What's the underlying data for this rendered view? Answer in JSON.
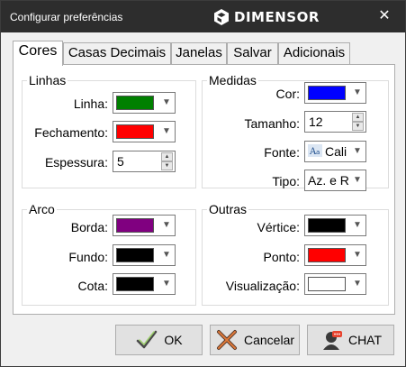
{
  "window": {
    "title": "Configurar preferências",
    "close_glyph": "✕"
  },
  "brand": {
    "name": "DIMENSOR",
    "icon": "dimensor-logo-icon"
  },
  "tabs": [
    {
      "label": "Cores",
      "active": true
    },
    {
      "label": "Casas Decimais",
      "active": false
    },
    {
      "label": "Janelas",
      "active": false
    },
    {
      "label": "Salvar",
      "active": false
    },
    {
      "label": "Adicionais",
      "active": false
    }
  ],
  "linhas": {
    "title": "Linhas",
    "linha": {
      "label": "Linha:",
      "color": "#008000"
    },
    "fechamento": {
      "label": "Fechamento:",
      "color": "#ff0000"
    },
    "espessura": {
      "label": "Espessura:",
      "value": "5"
    }
  },
  "medidas": {
    "title": "Medidas",
    "cor": {
      "label": "Cor:",
      "color": "#0000ff"
    },
    "tamanho": {
      "label": "Tamanho:",
      "value": "12"
    },
    "fonte": {
      "label": "Fonte:",
      "value": "Cali"
    },
    "tipo": {
      "label": "Tipo:",
      "value": "Az. e R"
    }
  },
  "arco": {
    "title": "Arco",
    "borda": {
      "label": "Borda:",
      "color": "#800080"
    },
    "fundo": {
      "label": "Fundo:",
      "color": "#000000"
    },
    "cota": {
      "label": "Cota:",
      "color": "#000000"
    }
  },
  "outras": {
    "title": "Outras",
    "vertice": {
      "label": "Vértice:",
      "color": "#000000"
    },
    "ponto": {
      "label": "Ponto:",
      "color": "#ff0000"
    },
    "visualizacao": {
      "label": "Visualização:",
      "color": "#ffffff"
    }
  },
  "buttons": {
    "ok": {
      "label": "OK",
      "icon": "checkmark-icon"
    },
    "cancel": {
      "label": "Cancelar",
      "icon": "cancel-x-icon"
    },
    "chat": {
      "label": "CHAT",
      "icon": "chat-icon"
    }
  }
}
